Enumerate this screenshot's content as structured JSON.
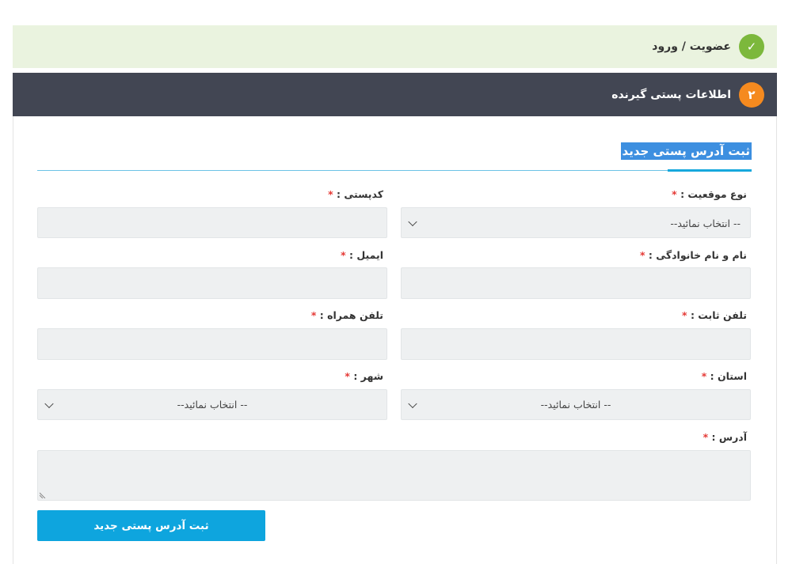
{
  "steps": {
    "step1": {
      "number": "✓",
      "title": "عضویت / ورود"
    },
    "step2": {
      "number": "۲",
      "title": "اطلاعات پستی گیرنده"
    }
  },
  "form": {
    "section_title": "ثبت آدرس پستی جدید",
    "required_mark": "*",
    "location_type": {
      "label": "نوع موقعیت :",
      "value": "-- انتخاب نمائید--"
    },
    "postal_code": {
      "label": "کدپستی :",
      "value": ""
    },
    "full_name": {
      "label": "نام و نام خانوادگی :",
      "value": ""
    },
    "email": {
      "label": "ایمیل :",
      "value": ""
    },
    "landline": {
      "label": "تلفن ثابت :",
      "value": ""
    },
    "mobile": {
      "label": "تلفن همراه :",
      "value": ""
    },
    "province": {
      "label": "استان :",
      "value": "-- انتخاب نمائید--"
    },
    "city": {
      "label": "شهر :",
      "value": "-- انتخاب نمائید--"
    },
    "address": {
      "label": "آدرس :",
      "value": ""
    },
    "submit_label": "ثبت آدرس پستی جدید"
  },
  "colors": {
    "step1_bg": "#eaf3df",
    "step1_circle": "#7cb83c",
    "step2_bg": "#424653",
    "step2_circle": "#f58a1f",
    "accent": "#0ea5de",
    "required": "#e53935"
  }
}
